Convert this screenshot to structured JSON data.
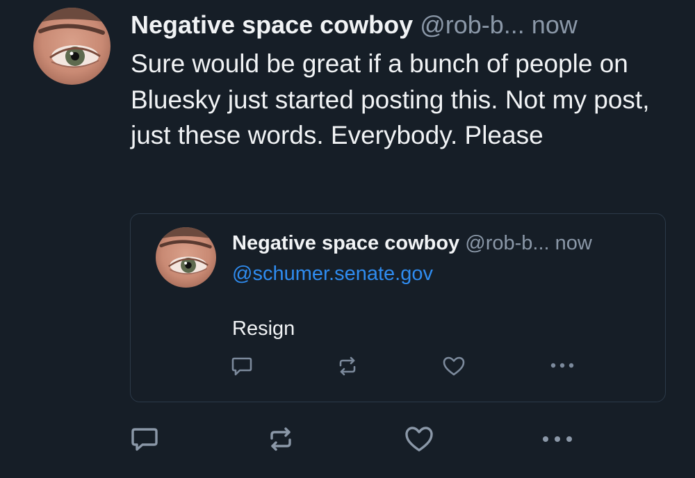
{
  "post": {
    "author": "Negative space cowboy",
    "handle": "@rob-b...",
    "time": "now",
    "text": "Sure would be great if a bunch of people on Bluesky just started posting this. Not my post, just these words. Everybody. Please"
  },
  "quote": {
    "author": "Negative space cowboy",
    "handle": "@rob-b...",
    "time": "now",
    "mention": "@schumer.senate.gov",
    "text": "Resign"
  },
  "icons": {
    "reply": "reply-icon",
    "repost": "repost-icon",
    "like": "like-icon",
    "more": "more-icon"
  },
  "colors": {
    "background": "#161e27",
    "text": "#f1f3f5",
    "muted": "#8b98a8",
    "link": "#2f8cf0",
    "border": "#2c3a49"
  }
}
